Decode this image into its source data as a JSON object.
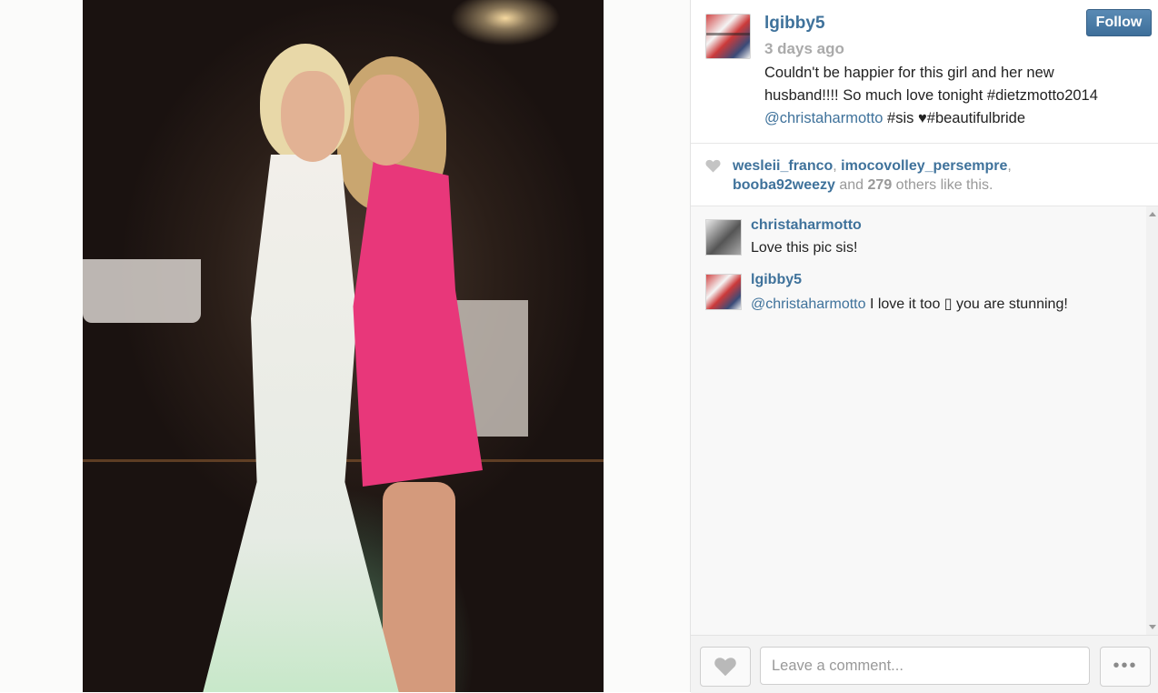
{
  "post": {
    "username": "lgibby5",
    "time_ago": "3 days ago",
    "follow_label": "Follow",
    "caption_line1": "Couldn't be happier for this girl and her new",
    "caption_line2": "husband!!!! So much love tonight #dietzmotto2014",
    "caption_mention": "@christaharmotto",
    "caption_tail": " #sis ♥#beautifulbride"
  },
  "likes": {
    "user1": "wesleii_franco",
    "sep1": ", ",
    "user2": "imocovolley_persempre",
    "sep2": ",",
    "user3": "booba92weezy",
    "and": " and ",
    "count": "279",
    "others": " others like this."
  },
  "comments": [
    {
      "username": "christaharmotto",
      "text": "Love this pic sis!"
    },
    {
      "username": "lgibby5",
      "mention": "@christaharmotto",
      "text": " I love it too ▯ you are stunning!"
    }
  ],
  "footer": {
    "comment_placeholder": "Leave a comment...",
    "more_label": "•••"
  },
  "colors": {
    "link": "#3f729b",
    "follow_button": "#4a7ba6",
    "muted": "#999999"
  },
  "icons": {
    "like": "heart-icon",
    "more": "ellipsis-icon"
  }
}
